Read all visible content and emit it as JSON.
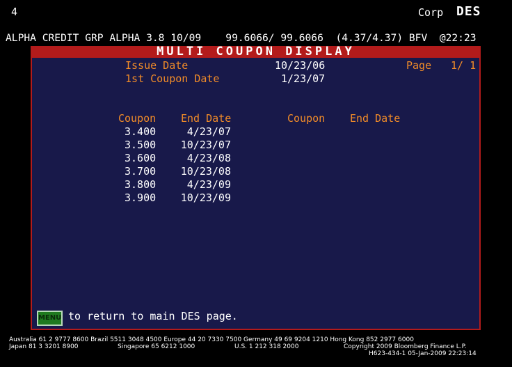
{
  "header": {
    "page_number": "4",
    "sector": "Corp",
    "function": "DES"
  },
  "ticker_line": "ALPHA CREDIT GRP ALPHA 3.8 10/09    99.6066/ 99.6066  (4.37/4.37) BFV  @22:23",
  "title": "MULTI  COUPON  DISPLAY",
  "info": {
    "issue_date_label": "Issue Date",
    "issue_date_value": "10/23/06",
    "first_coupon_label": "1st Coupon Date",
    "first_coupon_value": "1/23/07",
    "page_label": "Page",
    "page_value": "1/ 1"
  },
  "table": {
    "headers": [
      "Coupon",
      "End Date",
      "Coupon",
      "End Date"
    ],
    "rows": [
      {
        "coupon": "3.400",
        "end_date": "4/23/07"
      },
      {
        "coupon": "3.500",
        "end_date": "10/23/07"
      },
      {
        "coupon": "3.600",
        "end_date": "4/23/08"
      },
      {
        "coupon": "3.700",
        "end_date": "10/23/08"
      },
      {
        "coupon": "3.800",
        "end_date": "4/23/09"
      },
      {
        "coupon": "3.900",
        "end_date": "10/23/09"
      }
    ]
  },
  "menu": {
    "button_label": "MENU",
    "text": "to return to main DES page."
  },
  "footer": {
    "line1": "Australia 61 2 9777 8600 Brazil 5511 3048 4500 Europe 44 20 7330 7500 Germany 49 69 9204 1210 Hong Kong 852 2977 6000",
    "line2_left": "Japan 81 3 3201 8900",
    "line2_mid1": "Singapore 65 6212 1000",
    "line2_mid2": "U.S. 1 212 318 2000",
    "line2_right": "Copyright 2009 Bloomberg Finance L.P.",
    "line3": "H623-434-1 05-Jan-2009 22:23:14"
  },
  "colors": {
    "background": "#000000",
    "panel": "#18194a",
    "title_bar": "#b31b1b",
    "label": "#f28c28",
    "value": "#ffffff",
    "menu_button": "#1f7a1f"
  }
}
